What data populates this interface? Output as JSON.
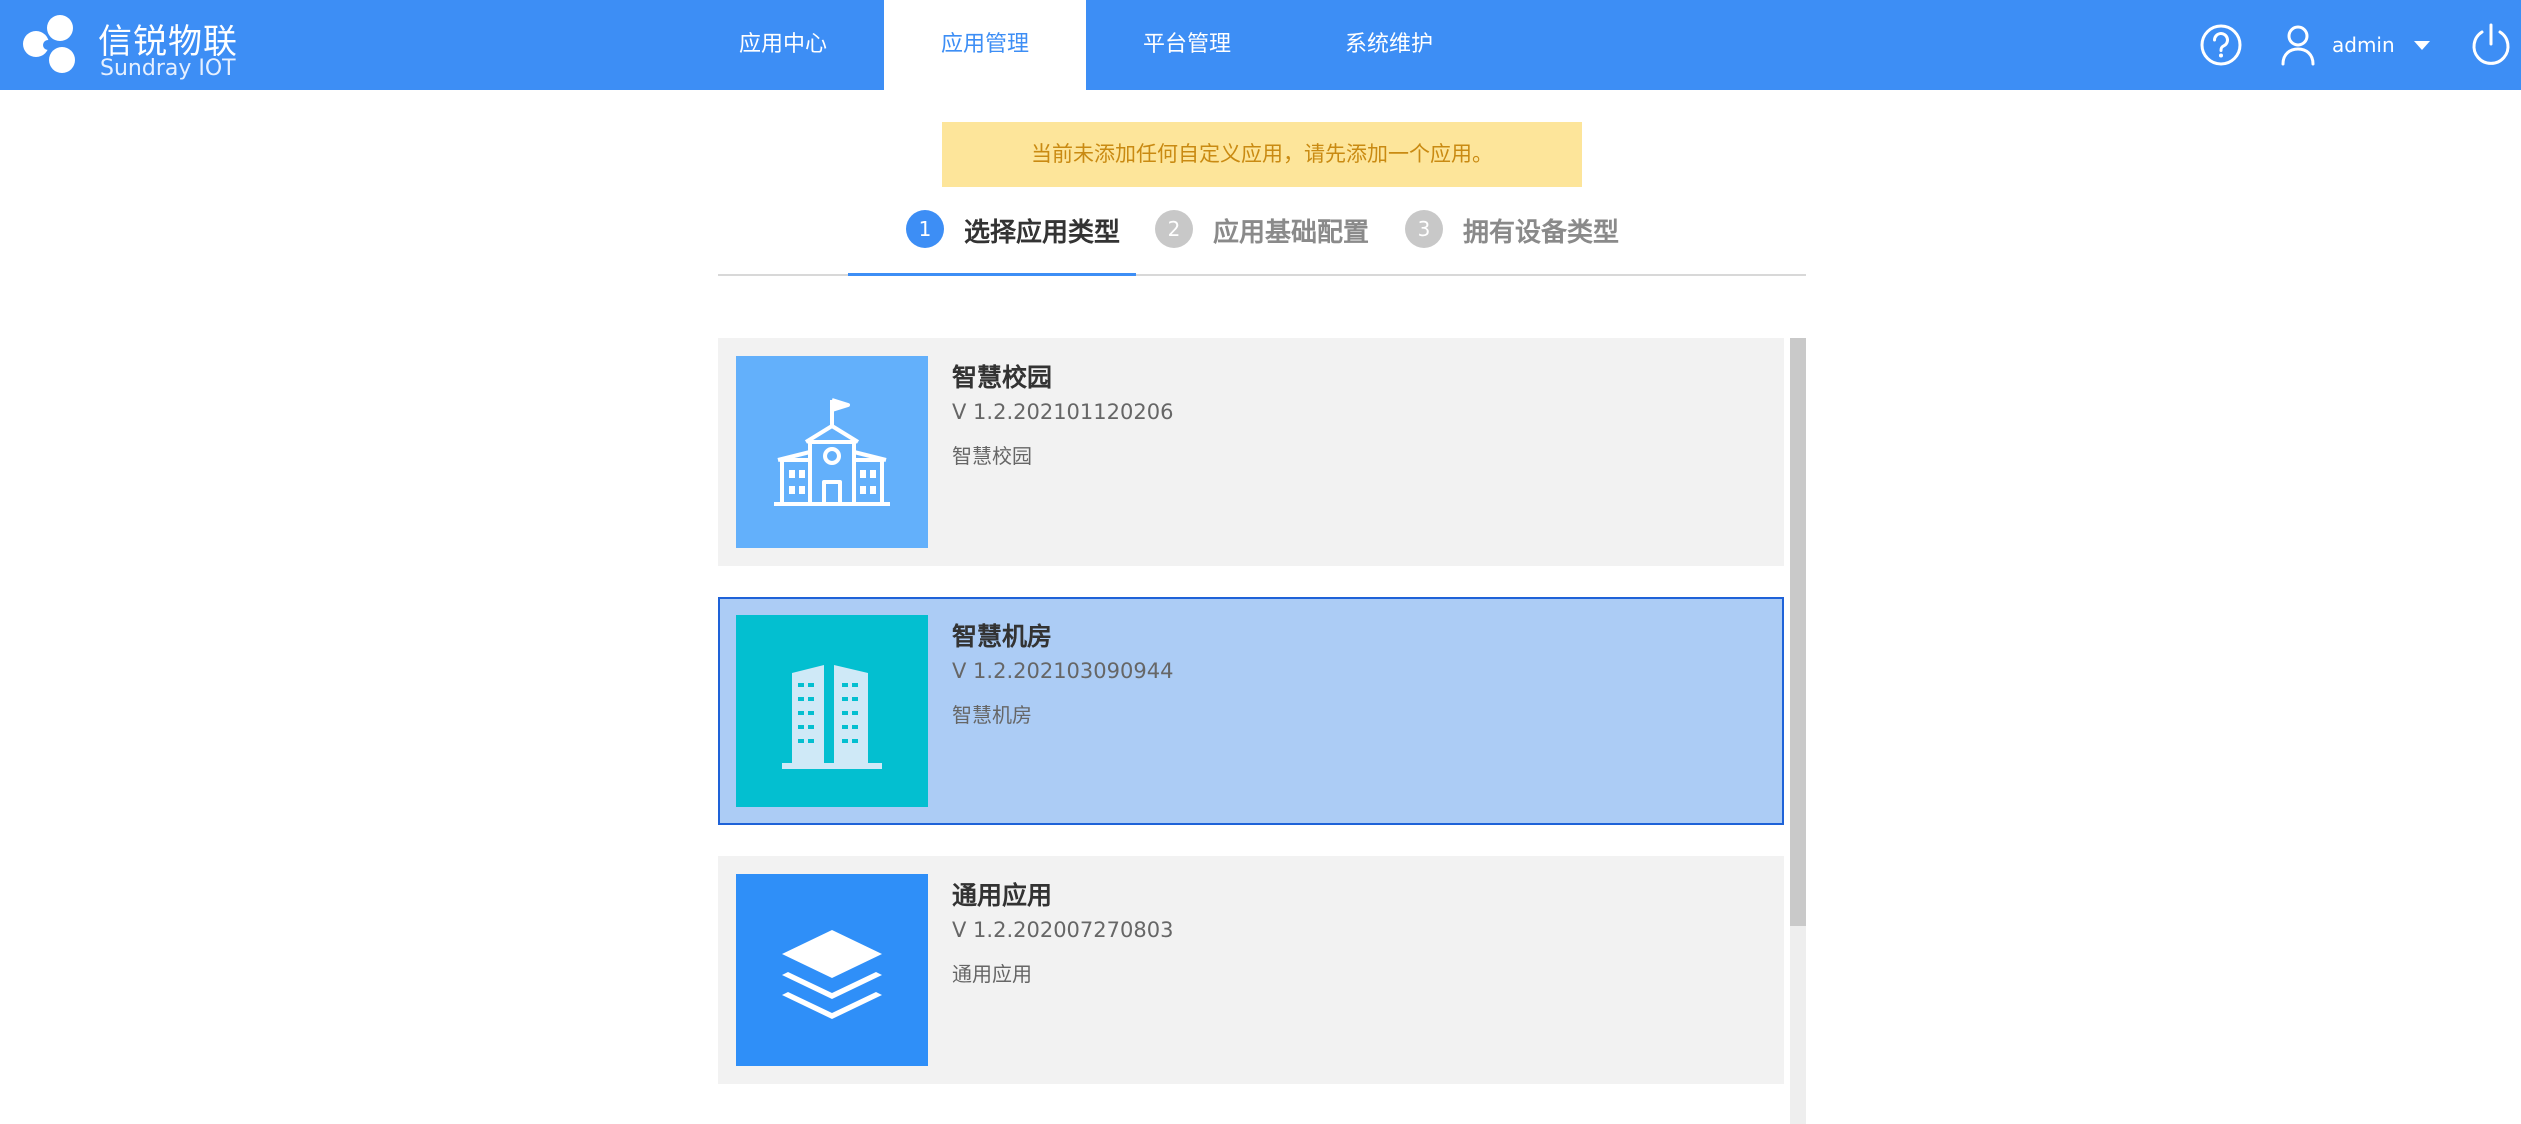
{
  "brand": {
    "name_cn": "信锐物联",
    "name_en": "Sundray IOT",
    "accent": "#3d8ef5"
  },
  "nav": {
    "items": [
      {
        "label": "应用中心"
      },
      {
        "label": "应用管理",
        "active": true
      },
      {
        "label": "平台管理"
      },
      {
        "label": "系统维护"
      }
    ]
  },
  "header_right": {
    "help_icon": "help-icon",
    "user_icon": "user-icon",
    "username": "admin",
    "dropdown_icon": "caret-down-icon",
    "power_icon": "power-icon"
  },
  "notice": {
    "text": "当前未添加任何自定义应用，请先添加一个应用。"
  },
  "steps": [
    {
      "num": "1",
      "label": "选择应用类型",
      "active": true
    },
    {
      "num": "2",
      "label": "应用基础配置"
    },
    {
      "num": "3",
      "label": "拥有设备类型"
    }
  ],
  "apps": [
    {
      "name": "智慧校园",
      "version": "V 1.2.202101120206",
      "desc": "智慧校园",
      "icon": "school-icon",
      "icon_bg": "#63b0fb"
    },
    {
      "name": "智慧机房",
      "version": "V 1.2.202103090944",
      "desc": "智慧机房",
      "icon": "buildings-icon",
      "icon_bg": "#03bfd0",
      "selected": true
    },
    {
      "name": "通用应用",
      "version": "V 1.2.202007270803",
      "desc": "通用应用",
      "icon": "layers-icon",
      "icon_bg": "#2f8ff8"
    }
  ]
}
